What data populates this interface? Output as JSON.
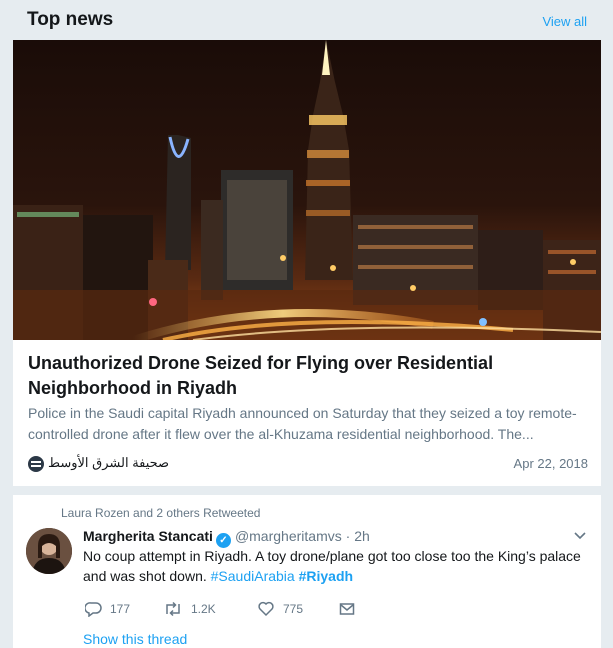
{
  "header": {
    "title": "Top news",
    "view_all": "View all"
  },
  "news": {
    "headline": "Unauthorized Drone Seized for Flying over Residential Neighborhood in Riyadh",
    "summary": "Police in the Saudi capital Riyadh announced on Saturday that they seized a toy remote-controlled drone after it flew over the al-Khuzama residential neighborhood. The...",
    "source": "صحيفة الشرق الأوسط",
    "date": "Apr 22, 2018",
    "image_icon": "city-night-photo"
  },
  "tweet": {
    "retweeted_by": "Laura Rozen and 2 others Retweeted",
    "author_name": "Margherita Stancati",
    "handle": "@margheritamvs",
    "separator": "·",
    "time": "2h",
    "text": "No coup attempt in Riyadh. A toy drone/plane got too close too the King’s palace and was shot down.",
    "hashtag1": "#SaudiArabia",
    "hashtag2": "#Riyadh",
    "replies": "177",
    "retweets": "1.2K",
    "likes": "775",
    "show_thread": "Show this thread"
  },
  "colors": {
    "accent": "#1da1f2",
    "secondary_text": "#657786",
    "background": "#e6ecf0"
  }
}
